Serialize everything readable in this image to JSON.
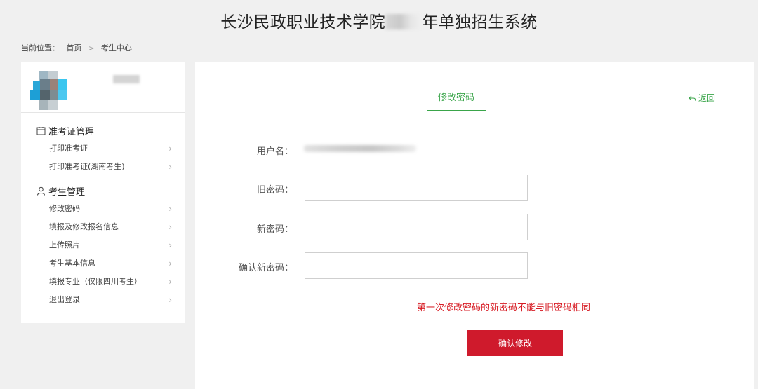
{
  "header": {
    "title_prefix": "长沙民政职业技术学院",
    "title_suffix": "年单独招生系统"
  },
  "breadcrumb": {
    "label": "当前位置：",
    "home": "首页",
    "separator": ">",
    "current": "考生中心"
  },
  "sidebar": {
    "groups": [
      {
        "title": "准考证管理",
        "icon": "calendar-icon",
        "items": [
          {
            "label": "打印准考证"
          },
          {
            "label": "打印准考证(湖南考生)"
          }
        ]
      },
      {
        "title": "考生管理",
        "icon": "user-icon",
        "items": [
          {
            "label": "修改密码"
          },
          {
            "label": "填报及修改报名信息"
          },
          {
            "label": "上传照片"
          },
          {
            "label": "考生基本信息"
          },
          {
            "label": "填报专业（仅限四川考生）"
          },
          {
            "label": "退出登录"
          }
        ]
      }
    ],
    "chevron": "›"
  },
  "main": {
    "tab_label": "修改密码",
    "back_label": "返回",
    "back_icon": "reply-arrow-icon",
    "fields": {
      "username_label": "用户名：",
      "old_password_label": "旧密码：",
      "new_password_label": "新密码：",
      "confirm_password_label": "确认新密码：",
      "old_password_value": "",
      "new_password_value": "",
      "confirm_password_value": ""
    },
    "warning": "第一次修改密码的新密码不能与旧密码相同",
    "confirm_button": "确认修改"
  },
  "colors": {
    "accent_green": "#3aa54a",
    "button_red": "#cf1a2c",
    "warning_red": "#d71d25"
  }
}
